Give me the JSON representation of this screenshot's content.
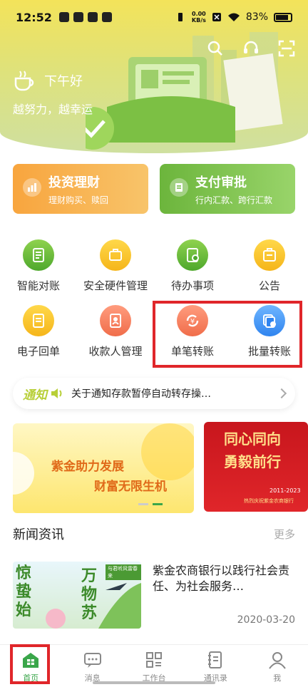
{
  "status_bar": {
    "time": "12:52",
    "net_speed_top": "0.00",
    "net_speed_bottom": "KB/s",
    "battery": "83%"
  },
  "header": {
    "greeting": "下午好",
    "slogan": "越努力，越幸运"
  },
  "promos": [
    {
      "title": "投资理财",
      "subtitle": "理财购买、赎回"
    },
    {
      "title": "支付审批",
      "subtitle": "行内汇款、跨行汇款"
    }
  ],
  "functions_row1": [
    {
      "label": "智能对账",
      "icon": "reconcile-icon"
    },
    {
      "label": "安全硬件管理",
      "icon": "hardware-icon"
    },
    {
      "label": "待办事项",
      "icon": "todo-icon"
    },
    {
      "label": "公告",
      "icon": "announcement-icon"
    }
  ],
  "functions_row2": [
    {
      "label": "电子回单",
      "icon": "receipt-icon"
    },
    {
      "label": "收款人管理",
      "icon": "payee-icon"
    },
    {
      "label": "单笔转账",
      "icon": "single-transfer-icon"
    },
    {
      "label": "批量转账",
      "icon": "batch-transfer-icon"
    }
  ],
  "notice": {
    "tag": "通知",
    "text": "关于通知存款暂停自动转存操…"
  },
  "carousel": {
    "slide1_line1": "紫金助力发展",
    "slide1_line2": "财富无限生机",
    "slide2_line1": "同心同向",
    "slide2_line2": "勇毅前行",
    "slide2_years": "2011-2023",
    "slide2_caption": "热烈庆祝紫金农商银行"
  },
  "news": {
    "section_title": "新闻资讯",
    "more": "更多",
    "item": {
      "thumb_text1": "惊蛰始",
      "thumb_text2": "万物苏",
      "thumb_badge": "与君听风雷春来",
      "headline": "紫金农商银行以践行社会责任、为社会服务…",
      "date": "2020-03-20"
    }
  },
  "tabbar": [
    {
      "label": "首页",
      "icon": "home-icon",
      "active": true
    },
    {
      "label": "消息",
      "icon": "message-icon",
      "active": false
    },
    {
      "label": "工作台",
      "icon": "workbench-icon",
      "active": false
    },
    {
      "label": "通讯录",
      "icon": "contacts-icon",
      "active": false
    },
    {
      "label": "我",
      "icon": "profile-icon",
      "active": false
    }
  ],
  "colors": {
    "accent_green": "#3aa64a",
    "highlight_red": "#e0262a",
    "promo_orange": "#f8a53e",
    "promo_green": "#6cb53c"
  }
}
